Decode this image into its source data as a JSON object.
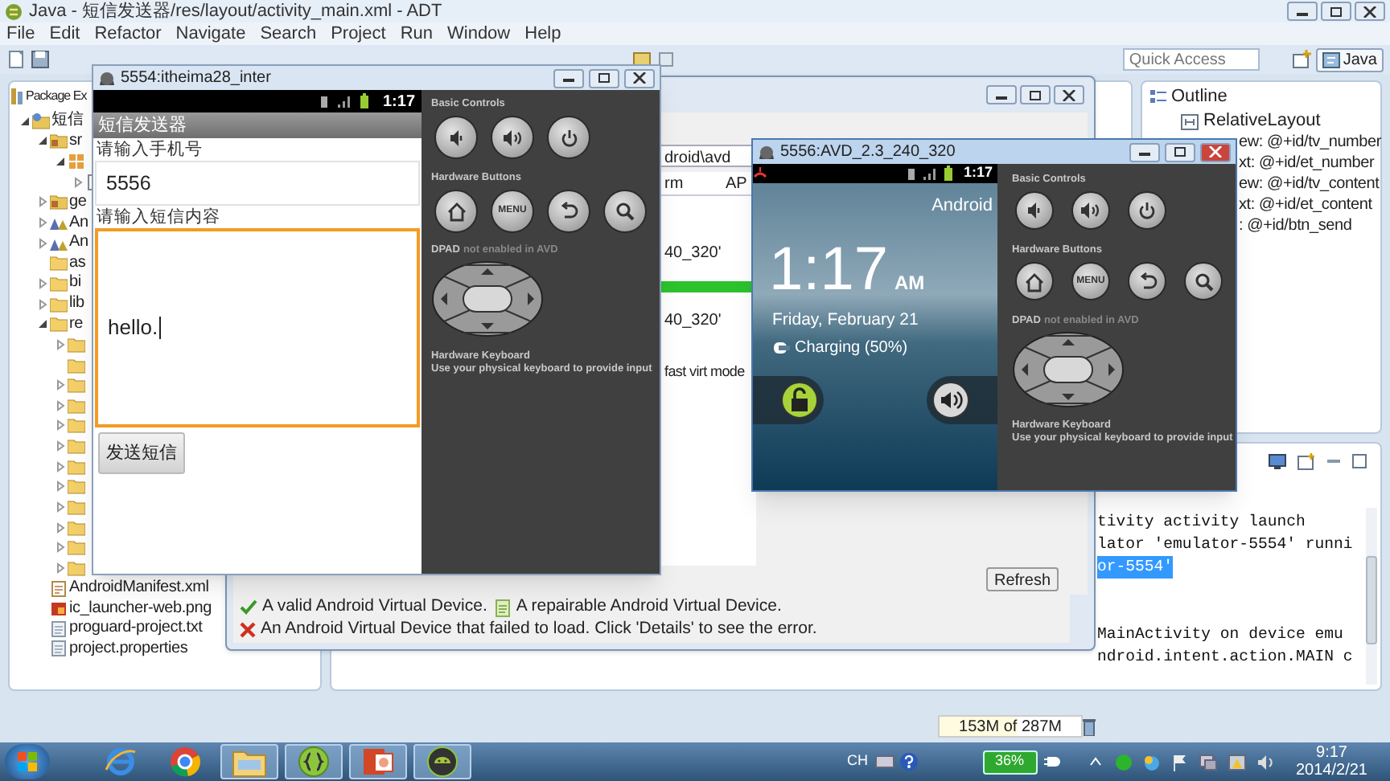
{
  "ide": {
    "title": "Java - 短信发送器/res/layout/activity_main.xml - ADT",
    "menu": [
      "File",
      "Edit",
      "Refactor",
      "Navigate",
      "Search",
      "Project",
      "Run",
      "Window",
      "Help"
    ],
    "quick_access": {
      "placeholder": "Quick Access"
    },
    "perspective": "Java"
  },
  "package_explorer": {
    "tab": "Package Ex",
    "items": [
      {
        "kind": "project",
        "label": "短信",
        "expanded": true,
        "children": [
          {
            "kind": "source",
            "label": "sr",
            "expanded": true,
            "children": [
              {
                "kind": "package",
                "expanded": true,
                "children": [
                  {
                    "kind": "file",
                    "expanded": false
                  }
                ]
              }
            ]
          },
          {
            "kind": "source",
            "label": "ge",
            "expanded": false
          },
          {
            "kind": "library",
            "label": "An",
            "expanded": false
          },
          {
            "kind": "library",
            "label": "An",
            "expanded": false
          },
          {
            "kind": "folder",
            "label": "as"
          },
          {
            "kind": "folder",
            "label": "bi",
            "expanded": false
          },
          {
            "kind": "folder",
            "label": "lib",
            "expanded": false
          },
          {
            "kind": "folder",
            "label": "re",
            "expanded": true,
            "children": [
              {
                "kind": "folder",
                "expanded": false
              },
              {
                "kind": "folder"
              },
              {
                "kind": "folder",
                "expanded": false
              },
              {
                "kind": "folder",
                "expanded": false
              },
              {
                "kind": "folder",
                "expanded": false
              },
              {
                "kind": "folder",
                "expanded": false
              },
              {
                "kind": "folder",
                "expanded": false
              },
              {
                "kind": "folder",
                "expanded": false
              },
              {
                "kind": "folder",
                "expanded": false
              },
              {
                "kind": "folder",
                "expanded": false
              },
              {
                "kind": "folder",
                "expanded": false
              },
              {
                "kind": "folder",
                "expanded": false
              }
            ]
          },
          {
            "kind": "xml",
            "label": "AndroidManifest.xml"
          },
          {
            "kind": "image",
            "label": "ic_launcher-web.png"
          },
          {
            "kind": "text",
            "label": "proguard-project.txt"
          },
          {
            "kind": "text",
            "label": "project.properties"
          }
        ]
      }
    ]
  },
  "avd_manager": {
    "path_field": "droid\\avd",
    "columns": [
      "rm",
      "AP"
    ],
    "cells": [
      "40_320'",
      "40_320'",
      "fast virt mode"
    ],
    "refresh": "Refresh",
    "legend": [
      {
        "kind": "valid",
        "text": "A valid Android Virtual Device."
      },
      {
        "kind": "repairable",
        "text": "A repairable Android Virtual Device."
      },
      {
        "kind": "failed",
        "text": "An Android Virtual Device that failed to load. Click 'Details' to see the error."
      }
    ]
  },
  "outline": {
    "tab": "Outline",
    "root": "RelativeLayout",
    "children": [
      "ew: @+id/tv_number",
      "xt: @+id/et_number",
      "ew: @+id/tv_content",
      "xt: @+id/et_content",
      ": @+id/btn_send"
    ]
  },
  "console": {
    "blocks": [
      [
        {
          "text": "tivity activity launch",
          "selected": false
        },
        {
          "text": "lator 'emulator-5554' runni",
          "selected": false
        },
        {
          "text": "or-5554'",
          "selected": true
        }
      ],
      [
        {
          "text": "MainActivity on device emu",
          "selected": false
        },
        {
          "text": "ndroid.intent.action.MAIN c",
          "selected": false
        }
      ]
    ]
  },
  "status_bar": {
    "memory": "153M of 287M"
  },
  "emulators": [
    {
      "title": "5554:itheima28_inter",
      "active": false,
      "status_time": "1:17",
      "screen": {
        "kind": "app",
        "app_title": "短信发送器",
        "fields": [
          {
            "label": "请输入手机号",
            "value": "5556",
            "focused": false,
            "multiline": false
          },
          {
            "label": "请输入短信内容",
            "value": "hello.",
            "focused": true,
            "multiline": true
          }
        ],
        "button": "发送短信"
      },
      "controls": {
        "basic_label": "Basic Controls",
        "hardware_label": "Hardware Buttons",
        "menu_key": "MENU",
        "dpad_label": "DPAD",
        "dpad_note": "not enabled in AVD",
        "keyboard_title": "Hardware Keyboard",
        "keyboard_hint": "Use your physical keyboard to provide input"
      }
    },
    {
      "title": "5556:AVD_2.3_240_320",
      "active": true,
      "status_time": "1:17",
      "screen": {
        "kind": "lockscreen",
        "carrier": "Android",
        "clock": "1:17",
        "ampm": "AM",
        "date": "Friday, February 21",
        "charging": "Charging (50%)"
      },
      "controls": {
        "basic_label": "Basic Controls",
        "hardware_label": "Hardware Buttons",
        "menu_key": "MENU",
        "dpad_label": "DPAD",
        "dpad_note": "not enabled in AVD",
        "keyboard_title": "Hardware Keyboard",
        "keyboard_hint": "Use your physical keyboard to provide input"
      }
    }
  ],
  "taskbar": {
    "apps": [
      {
        "kind": "ie",
        "pinned": false
      },
      {
        "kind": "chrome",
        "pinned": false
      },
      {
        "kind": "explorer",
        "pinned": true
      },
      {
        "kind": "eclipse",
        "pinned": true
      },
      {
        "kind": "powerpoint",
        "pinned": true
      },
      {
        "kind": "android",
        "pinned": true
      }
    ],
    "input_method": "CH",
    "battery": "36%",
    "time": "9:17",
    "date": "2014/2/21"
  }
}
